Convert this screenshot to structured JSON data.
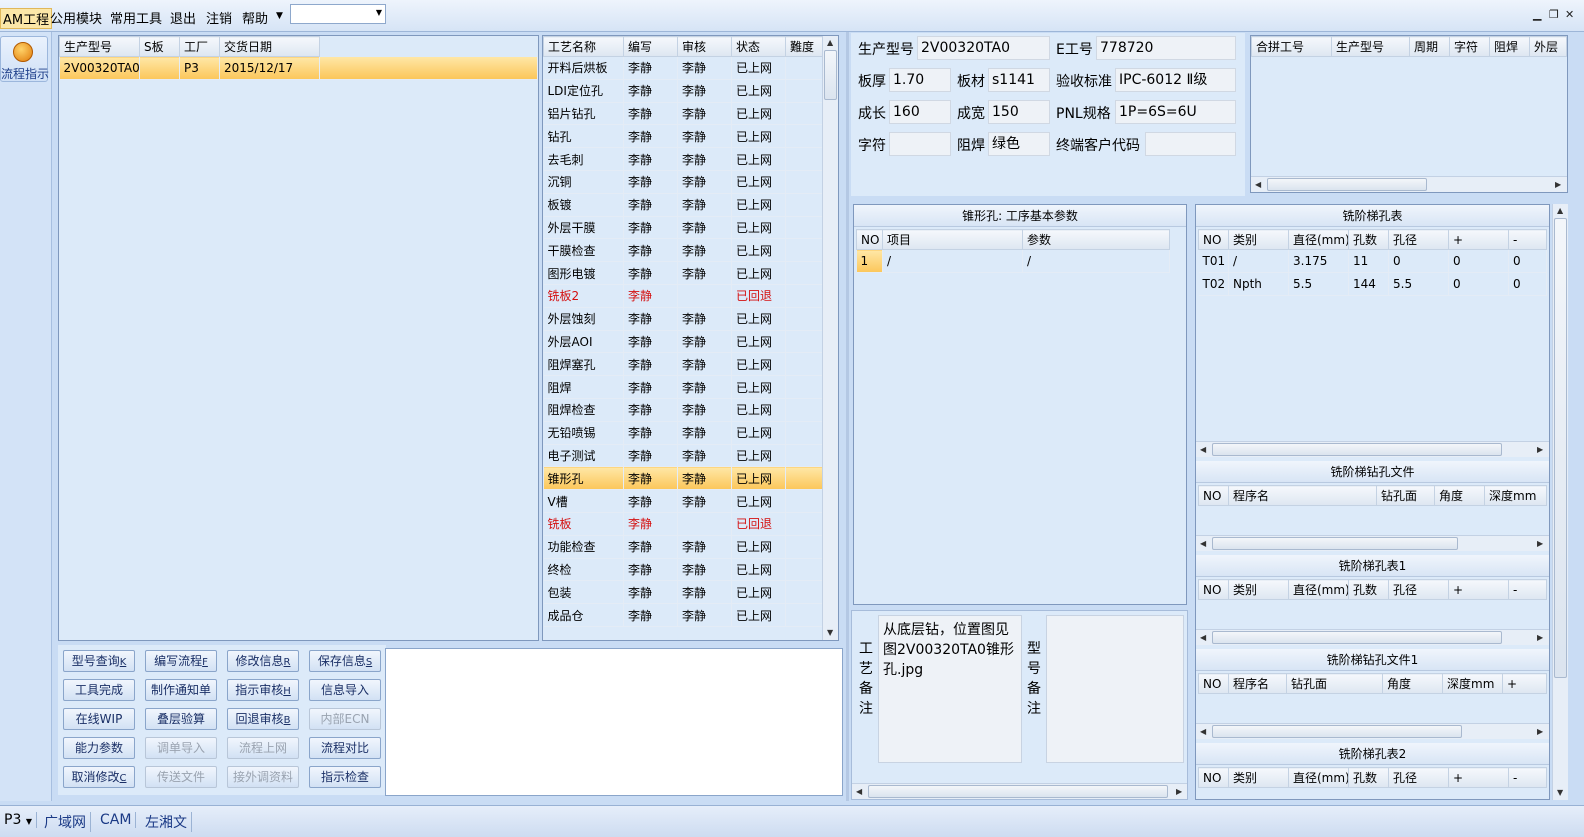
{
  "menu": {
    "items": [
      "AM工程",
      "公用模块",
      "常用工具",
      "退出",
      "注销",
      "帮助"
    ],
    "combo_value": ""
  },
  "sidebar": {
    "flow_label": "流程指示"
  },
  "orders": {
    "columns": [
      "生产型号",
      "S板",
      "工厂",
      "交货日期"
    ],
    "rows": [
      [
        "2V00320TA0",
        "",
        "P3",
        "2015/12/17"
      ]
    ]
  },
  "process": {
    "columns": [
      "工艺名称",
      "编写",
      "审核",
      "状态",
      "難度"
    ],
    "rows": [
      {
        "name": "开料后烘板",
        "author": "李静",
        "reviewer": "李静",
        "status": "已上网"
      },
      {
        "name": "LDI定位孔",
        "author": "李静",
        "reviewer": "李静",
        "status": "已上网"
      },
      {
        "name": "铝片钻孔",
        "author": "李静",
        "reviewer": "李静",
        "status": "已上网"
      },
      {
        "name": "钻孔",
        "author": "李静",
        "reviewer": "李静",
        "status": "已上网"
      },
      {
        "name": "去毛刺",
        "author": "李静",
        "reviewer": "李静",
        "status": "已上网"
      },
      {
        "name": "沉铜",
        "author": "李静",
        "reviewer": "李静",
        "status": "已上网"
      },
      {
        "name": "板镀",
        "author": "李静",
        "reviewer": "李静",
        "status": "已上网"
      },
      {
        "name": "外层干膜",
        "author": "李静",
        "reviewer": "李静",
        "status": "已上网"
      },
      {
        "name": "干膜检查",
        "author": "李静",
        "reviewer": "李静",
        "status": "已上网"
      },
      {
        "name": "图形电镀",
        "author": "李静",
        "reviewer": "李静",
        "status": "已上网"
      },
      {
        "name": "铣板2",
        "author": "李静",
        "reviewer": "",
        "status": "已回退",
        "red": true
      },
      {
        "name": "外层蚀刻",
        "author": "李静",
        "reviewer": "李静",
        "status": "已上网"
      },
      {
        "name": "外层AOI",
        "author": "李静",
        "reviewer": "李静",
        "status": "已上网"
      },
      {
        "name": "阻焊塞孔",
        "author": "李静",
        "reviewer": "李静",
        "status": "已上网"
      },
      {
        "name": "阻焊",
        "author": "李静",
        "reviewer": "李静",
        "status": "已上网"
      },
      {
        "name": "阻焊检查",
        "author": "李静",
        "reviewer": "李静",
        "status": "已上网"
      },
      {
        "name": "无铅喷锡",
        "author": "李静",
        "reviewer": "李静",
        "status": "已上网"
      },
      {
        "name": "电子测试",
        "author": "李静",
        "reviewer": "李静",
        "status": "已上网"
      },
      {
        "name": "锥形孔",
        "author": "李静",
        "reviewer": "李静",
        "status": "已上网",
        "selected": true
      },
      {
        "name": "V槽",
        "author": "李静",
        "reviewer": "李静",
        "status": "已上网"
      },
      {
        "name": "铣板",
        "author": "李静",
        "reviewer": "",
        "status": "已回退",
        "red": true
      },
      {
        "name": "功能检查",
        "author": "李静",
        "reviewer": "李静",
        "status": "已上网"
      },
      {
        "name": "终检",
        "author": "李静",
        "reviewer": "李静",
        "status": "已上网"
      },
      {
        "name": "包装",
        "author": "李静",
        "reviewer": "李静",
        "status": "已上网"
      },
      {
        "name": "成品仓",
        "author": "李静",
        "reviewer": "李静",
        "status": "已上网"
      }
    ]
  },
  "buttons": [
    {
      "label": "型号查询",
      "key": "K",
      "disabled": false
    },
    {
      "label": "编写流程",
      "key": "F",
      "disabled": false
    },
    {
      "label": "修改信息",
      "key": "R",
      "disabled": false
    },
    {
      "label": "保存信息",
      "key": "S",
      "disabled": false
    },
    {
      "label": "工具完成",
      "key": "",
      "disabled": false
    },
    {
      "label": "制作通知单",
      "key": "",
      "disabled": false
    },
    {
      "label": "指示审核",
      "key": "H",
      "disabled": false
    },
    {
      "label": "信息导入",
      "key": "",
      "disabled": false
    },
    {
      "label": "在线WIP",
      "key": "",
      "disabled": false
    },
    {
      "label": "叠层验算",
      "key": "",
      "disabled": false
    },
    {
      "label": "回退审核",
      "key": "B",
      "disabled": false
    },
    {
      "label": "内部ECN",
      "key": "",
      "disabled": true
    },
    {
      "label": "能力参数",
      "key": "",
      "disabled": false
    },
    {
      "label": "调单导入",
      "key": "",
      "disabled": true
    },
    {
      "label": "流程上网",
      "key": "",
      "disabled": true
    },
    {
      "label": "流程对比",
      "key": "",
      "disabled": false
    },
    {
      "label": "取消修改",
      "key": "C",
      "disabled": false
    },
    {
      "label": "传送文件",
      "key": "",
      "disabled": true
    },
    {
      "label": "接外调资料",
      "key": "",
      "disabled": true
    },
    {
      "label": "指示检查",
      "key": "",
      "disabled": false
    }
  ],
  "info": {
    "prod_model_label": "生产型号",
    "prod_model": "2V00320TA0",
    "e_no_label": "E工号",
    "e_no": "778720",
    "thickness_label": "板厚",
    "thickness": "1.70",
    "material_label": "板材",
    "material": "s1141",
    "standard_label": "验收标准",
    "standard": "IPC-6012 Ⅱ级",
    "length_label": "成长",
    "length": "160",
    "width_label": "成宽",
    "width": "150",
    "pnl_label": "PNL规格",
    "pnl": "1P=6S=6U",
    "char_label": "字符",
    "char": "",
    "mask_label": "阻焊",
    "mask": "绿色",
    "customer_label": "终端客户代码",
    "customer": ""
  },
  "combine": {
    "columns": [
      "合拼工号",
      "生产型号",
      "周期",
      "字符",
      "阻焊",
      "外层"
    ]
  },
  "params": {
    "title": "锥形孔: 工序基本参数",
    "columns": [
      "NO",
      "项目",
      "参数"
    ],
    "rows": [
      [
        "1",
        "/",
        "/"
      ]
    ]
  },
  "notes": {
    "process_label": "工艺备注",
    "process_text": "从底层钻，位置图见图2V00320TA0锥形孔.jpg",
    "model_label": "型号备注"
  },
  "mill_table": {
    "title": "铣阶梯孔表",
    "columns": [
      "NO",
      "类别",
      "直径(mm)",
      "孔数",
      "孔径",
      "+",
      "-"
    ],
    "rows": [
      [
        "T01",
        "/",
        "3.175",
        "11",
        "0",
        "0",
        "0"
      ],
      [
        "T02",
        "Npth",
        "5.5",
        "144",
        "5.5",
        "0",
        "0"
      ]
    ]
  },
  "mill_file": {
    "title": "铣阶梯钻孔文件",
    "columns": [
      "NO",
      "程序名",
      "钻孔面",
      "角度",
      "深度mm"
    ]
  },
  "mill_table1": {
    "title": "铣阶梯孔表1",
    "columns": [
      "NO",
      "类别",
      "直径(mm)",
      "孔数",
      "孔径",
      "+",
      "-"
    ]
  },
  "mill_file1": {
    "title": "铣阶梯钻孔文件1",
    "columns": [
      "NO",
      "程序名",
      "钻孔面",
      "角度",
      "深度mm",
      "+"
    ]
  },
  "mill_table2": {
    "title": "铣阶梯孔表2",
    "columns": [
      "NO",
      "类别",
      "直径(mm)",
      "孔数",
      "孔径",
      "+",
      "-"
    ]
  },
  "status": {
    "factory": "P3",
    "tabs": [
      "广域网",
      "CAM",
      "左湘文"
    ]
  }
}
